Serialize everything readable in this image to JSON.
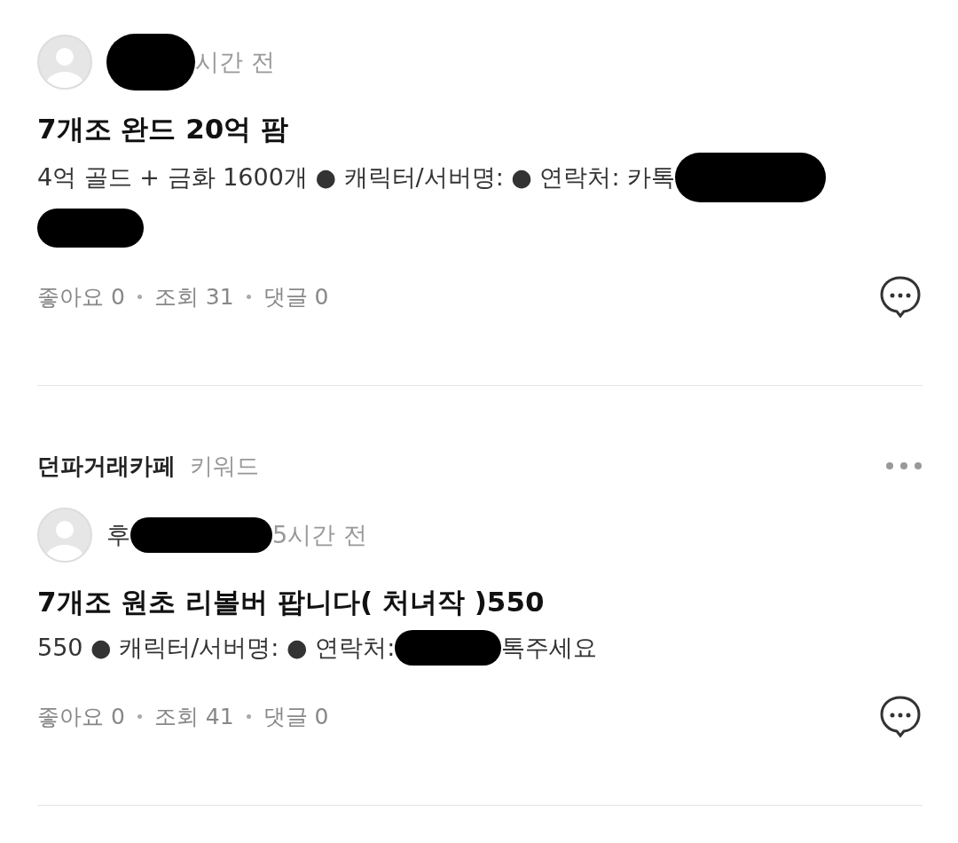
{
  "posts": [
    {
      "author": [
        {
          "kind": "redaction"
        },
        {
          "kind": "time",
          "text": "시간 전"
        }
      ],
      "title": "7개조 완드 20억 팜",
      "body": [
        [
          {
            "kind": "text",
            "text": "4억 골드 + 금화 1600개 ● 캐릭터/서버명: ● 연락처: 카톡"
          },
          {
            "kind": "redaction"
          }
        ],
        [
          {
            "kind": "redaction"
          }
        ]
      ],
      "stats": [
        "좋아요 0",
        "조회 31",
        "댓글 0"
      ]
    },
    {
      "cafe": {
        "name": "던파거래카페",
        "tag": "키워드"
      },
      "author": [
        {
          "kind": "name",
          "text": "후"
        },
        {
          "kind": "redaction"
        },
        {
          "kind": "time",
          "text": "5시간 전"
        }
      ],
      "title": "7개조 원초 리볼버 팝니다( 처녀작 )550",
      "body": [
        [
          {
            "kind": "text",
            "text": "550 ● 캐릭터/서버명: ● 연락처:"
          },
          {
            "kind": "redaction"
          },
          {
            "kind": "text",
            "text": "톡주세요"
          }
        ]
      ],
      "stats": [
        "좋아요 0",
        "조회 41",
        "댓글 0"
      ]
    }
  ]
}
